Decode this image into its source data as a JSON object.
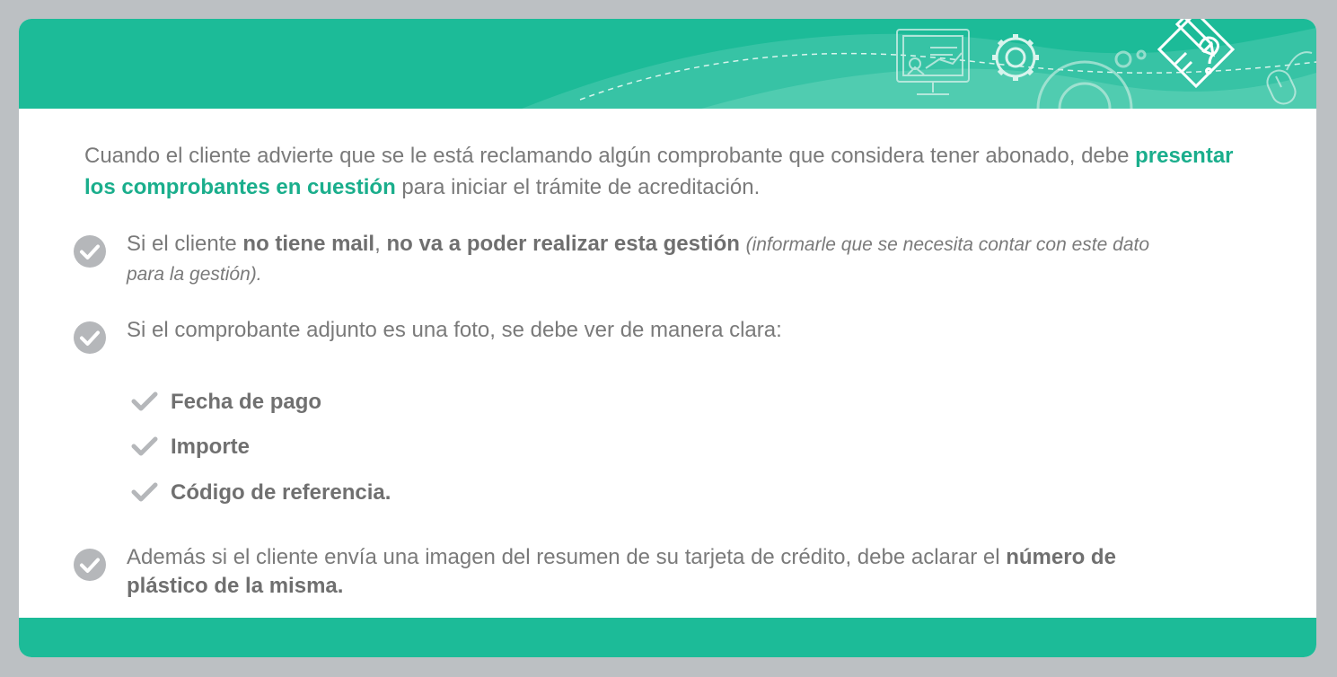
{
  "colors": {
    "accent": "#1cbb98",
    "text": "#7a7a7a",
    "highlight": "#1aae8c",
    "background": "#bcc0c3"
  },
  "header": {
    "icons": [
      "presentation-board-icon",
      "gear-icon",
      "large-gear-icon",
      "document-question-pencil-icon",
      "mouse-icon"
    ]
  },
  "intro": {
    "before": "Cuando el cliente advierte que se le está reclamando algún comprobante que considera tener abonado, debe ",
    "highlight": "presentar los comprobantes en cuestión",
    "after": " para iniciar el trámite de acreditación."
  },
  "bullets": [
    {
      "p1": "Si el cliente ",
      "b1": "no tiene mail",
      "p2": ", ",
      "b2": "no va a poder realizar esta gestión",
      "p3": " ",
      "italic": "(informarle que se necesita contar con este dato para la gestión)."
    },
    {
      "text": "Si el comprobante adjunto es una foto, se debe ver de manera clara:"
    },
    {
      "text": "Además si el cliente envía una imagen del resumen de su tarjeta de crédito, debe aclarar el ",
      "bold": "número de plástico de la misma."
    }
  ],
  "checklist": [
    "Fecha de pago",
    "Importe",
    "Código de referencia."
  ]
}
